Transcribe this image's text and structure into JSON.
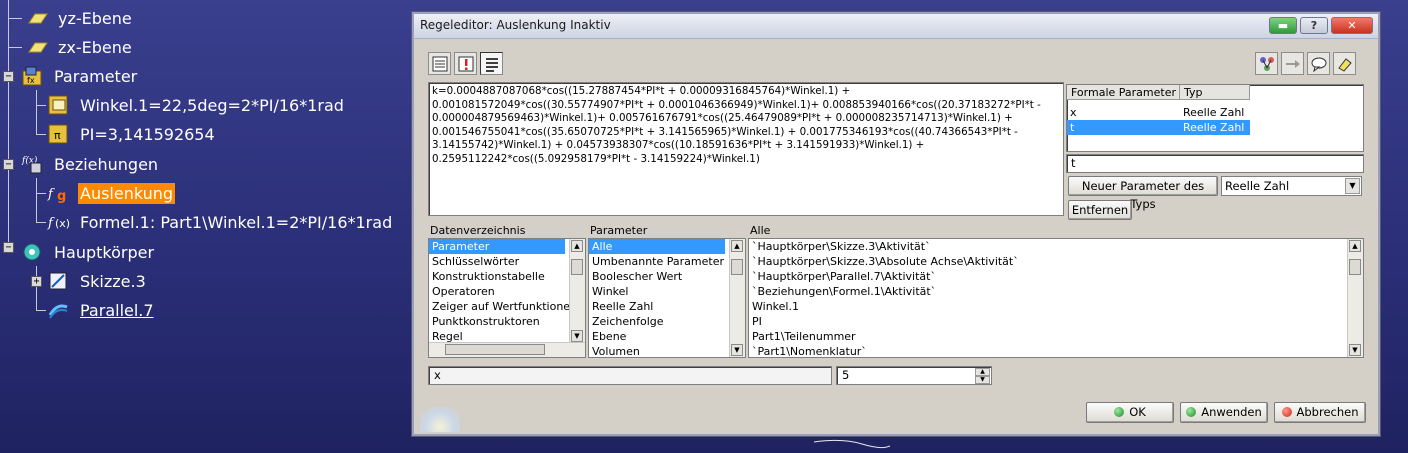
{
  "tree": {
    "items": [
      {
        "label": "yz-Ebene"
      },
      {
        "label": "zx-Ebene"
      },
      {
        "label": "Parameter"
      },
      {
        "label": "Winkel.1=22,5deg=2*PI/16*1rad"
      },
      {
        "label": "PI=3,141592654"
      },
      {
        "label": "Beziehungen"
      },
      {
        "label": "Auslenkung"
      },
      {
        "label": "Formel.1: Part1\\Winkel.1=2*PI/16*1rad"
      },
      {
        "label": "Hauptkörper"
      },
      {
        "label": "Skizze.3"
      },
      {
        "label": "Parallel.7"
      }
    ]
  },
  "dialog": {
    "title": "Regeleditor: Auslenkung Inaktiv",
    "title_buttons": {
      "minimize": "▬",
      "help": "?",
      "close": "✕"
    },
    "formula": "k=0.0004887087068*cos((15.27887454*PI*t + 0.00009316845764)*Winkel.1) + 0.001081572049*cos((30.55774907*PI*t + 0.0001046366949)*Winkel.1)+ 0.008853940166*cos((20.37183272*PI*t - 0.000004879569463)*Winkel.1)+ 0.005761676791*cos((25.46479089*PI*t + 0.000008235714713)*Winkel.1) + 0.001546755041*cos((35.65070725*PI*t + 3.141565965)*Winkel.1) + 0.001775346193*cos((40.74366543*PI*t - 3.14155742)*Winkel.1) + 0.04573938307*cos((10.18591636*PI*t + 3.141591933)*Winkel.1) + 0.2595112242*cos((5.092958179*PI*t - 3.14159224)*Winkel.1)",
    "params_table": {
      "headers": [
        "Formale Parameter",
        "Typ"
      ],
      "rows": [
        {
          "name": "x",
          "type": "Reelle Zahl"
        },
        {
          "name": "t",
          "type": "Reelle Zahl"
        }
      ]
    },
    "param_name_value": "t",
    "new_param_button": "Neuer Parameter des Typs",
    "new_param_type": "Reelle Zahl",
    "remove_button": "Entfernen",
    "lists": {
      "dir_label": "Datenverzeichnis",
      "dir_items": [
        "Parameter",
        "Schlüsselwörter",
        "Konstruktionstabelle",
        "Operatoren",
        "Zeiger auf Wertfunktionen",
        "Punktkonstruktoren",
        "Regel"
      ],
      "param_label": "Parameter",
      "param_items": [
        "Alle",
        "Umbenannte Parameter",
        "Boolescher Wert",
        "Winkel",
        "Reelle Zahl",
        "Zeichenfolge",
        "Ebene",
        "Volumen"
      ],
      "all_label": "Alle",
      "all_items": [
        "`Hauptkörper\\Skizze.3\\Aktivität`",
        "`Hauptkörper\\Skizze.3\\Absolute Achse\\Aktivität`",
        "`Hauptkörper\\Parallel.7\\Aktivität`",
        "`Beziehungen\\Formel.1\\Aktivität`",
        "Winkel.1",
        "PI",
        "Part1\\Teilenummer",
        "`Part1\\Nomenklatur`"
      ]
    },
    "bottom_field": "x",
    "bottom_value": "5",
    "buttons": {
      "ok": "OK",
      "apply": "Anwenden",
      "cancel": "Abbrechen"
    },
    "colors": {
      "selection": "#3399ff",
      "tree_highlight": "#ff8a00"
    }
  }
}
